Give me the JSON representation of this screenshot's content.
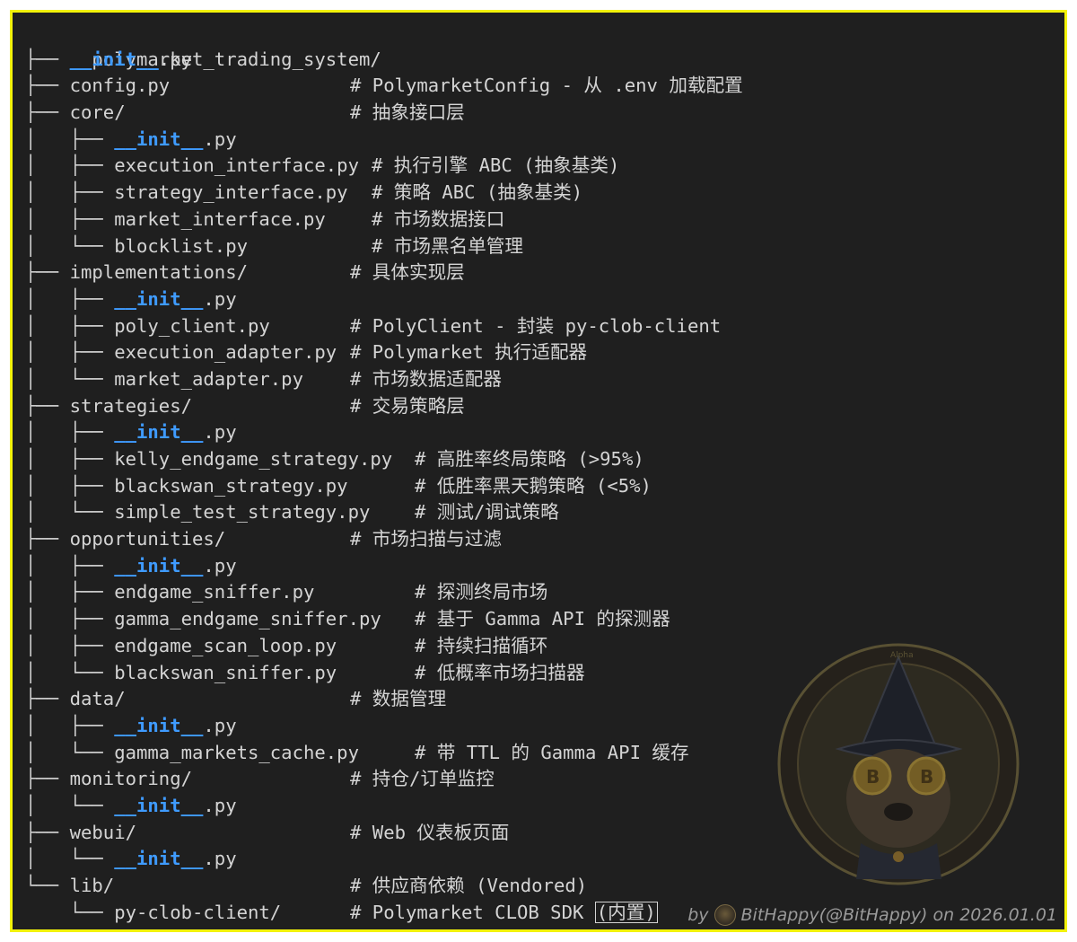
{
  "root": "polymarket_trading_system/",
  "lines": [
    {
      "prefix": "├── ",
      "name": "__init__",
      "ext": ".py",
      "init": true,
      "comment": "",
      "col": 0
    },
    {
      "prefix": "├── ",
      "name": "config.py",
      "init": false,
      "comment": "# PolymarketConfig - 从 .env 加载配置",
      "col": 1
    },
    {
      "prefix": "├── ",
      "name": "core/",
      "init": false,
      "comment": "# 抽象接口层",
      "col": 1
    },
    {
      "prefix": "│   ├── ",
      "name": "__init__",
      "ext": ".py",
      "init": true,
      "comment": "",
      "col": 0
    },
    {
      "prefix": "│   ├── ",
      "name": "execution_interface.py",
      "init": false,
      "comment": "# 执行引擎 ABC (抽象基类)",
      "col": 2
    },
    {
      "prefix": "│   ├── ",
      "name": "strategy_interface.py",
      "init": false,
      "comment": "# 策略 ABC (抽象基类)",
      "col": 2
    },
    {
      "prefix": "│   ├── ",
      "name": "market_interface.py",
      "init": false,
      "comment": "# 市场数据接口",
      "col": 2
    },
    {
      "prefix": "│   └── ",
      "name": "blocklist.py",
      "init": false,
      "comment": "# 市场黑名单管理",
      "col": 2
    },
    {
      "prefix": "├── ",
      "name": "implementations/",
      "init": false,
      "comment": "# 具体实现层",
      "col": 1
    },
    {
      "prefix": "│   ├── ",
      "name": "__init__",
      "ext": ".py",
      "init": true,
      "comment": "",
      "col": 0
    },
    {
      "prefix": "│   ├── ",
      "name": "poly_client.py",
      "init": false,
      "comment": "# PolyClient - 封装 py-clob-client",
      "col": 1
    },
    {
      "prefix": "│   ├── ",
      "name": "execution_adapter.py",
      "init": false,
      "comment": "# Polymarket 执行适配器",
      "col": 1
    },
    {
      "prefix": "│   └── ",
      "name": "market_adapter.py",
      "init": false,
      "comment": "# 市场数据适配器",
      "col": 1
    },
    {
      "prefix": "├── ",
      "name": "strategies/",
      "init": false,
      "comment": "# 交易策略层",
      "col": 1
    },
    {
      "prefix": "│   ├── ",
      "name": "__init__",
      "ext": ".py",
      "init": true,
      "comment": "",
      "col": 0
    },
    {
      "prefix": "│   ├── ",
      "name": "kelly_endgame_strategy.py",
      "init": false,
      "comment": "# 高胜率终局策略 (>95%)",
      "col": 3
    },
    {
      "prefix": "│   ├── ",
      "name": "blackswan_strategy.py",
      "init": false,
      "comment": "# 低胜率黑天鹅策略 (<5%)",
      "col": 3
    },
    {
      "prefix": "│   └── ",
      "name": "simple_test_strategy.py",
      "init": false,
      "comment": "# 测试/调试策略",
      "col": 3
    },
    {
      "prefix": "├── ",
      "name": "opportunities/",
      "init": false,
      "comment": "# 市场扫描与过滤",
      "col": 1
    },
    {
      "prefix": "│   ├── ",
      "name": "__init__",
      "ext": ".py",
      "init": true,
      "comment": "",
      "col": 0
    },
    {
      "prefix": "│   ├── ",
      "name": "endgame_sniffer.py",
      "init": false,
      "comment": "# 探测终局市场",
      "col": 3
    },
    {
      "prefix": "│   ├── ",
      "name": "gamma_endgame_sniffer.py",
      "init": false,
      "comment": "# 基于 Gamma API 的探测器",
      "col": 3
    },
    {
      "prefix": "│   ├── ",
      "name": "endgame_scan_loop.py",
      "init": false,
      "comment": "# 持续扫描循环",
      "col": 3
    },
    {
      "prefix": "│   └── ",
      "name": "blackswan_sniffer.py",
      "init": false,
      "comment": "# 低概率市场扫描器",
      "col": 3
    },
    {
      "prefix": "├── ",
      "name": "data/",
      "init": false,
      "comment": "# 数据管理",
      "col": 1
    },
    {
      "prefix": "│   ├── ",
      "name": "__init__",
      "ext": ".py",
      "init": true,
      "comment": "",
      "col": 0
    },
    {
      "prefix": "│   └── ",
      "name": "gamma_markets_cache.py",
      "init": false,
      "comment": "# 带 TTL 的 Gamma API 缓存",
      "col": 3
    },
    {
      "prefix": "├── ",
      "name": "monitoring/",
      "init": false,
      "comment": "# 持仓/订单监控",
      "col": 1
    },
    {
      "prefix": "│   └── ",
      "name": "__init__",
      "ext": ".py",
      "init": true,
      "comment": "",
      "col": 0
    },
    {
      "prefix": "├── ",
      "name": "webui/",
      "init": false,
      "comment": "# Web 仪表板页面",
      "col": 1
    },
    {
      "prefix": "│   └── ",
      "name": "__init__",
      "ext": ".py",
      "init": true,
      "comment": "",
      "col": 0
    },
    {
      "prefix": "└── ",
      "name": "lib/",
      "init": false,
      "comment": "# 供应商依赖 (Vendored)",
      "col": 1
    },
    {
      "prefix": "    └── ",
      "name": "py-clob-client/",
      "init": false,
      "comment": "# Polymarket CLOB SDK (内置)",
      "col": 1,
      "cursor": true
    }
  ],
  "credit": {
    "prefix": "by",
    "handle": "BitHappy(@BitHappy) on 2026.01.01"
  },
  "watermark": {
    "ring_text": "Alpha",
    "coin_symbol": "B"
  },
  "colors": {
    "background": "#1f1f1f",
    "border": "#f2f20a",
    "text": "#d4d4d4",
    "init": "#3f9bff"
  }
}
